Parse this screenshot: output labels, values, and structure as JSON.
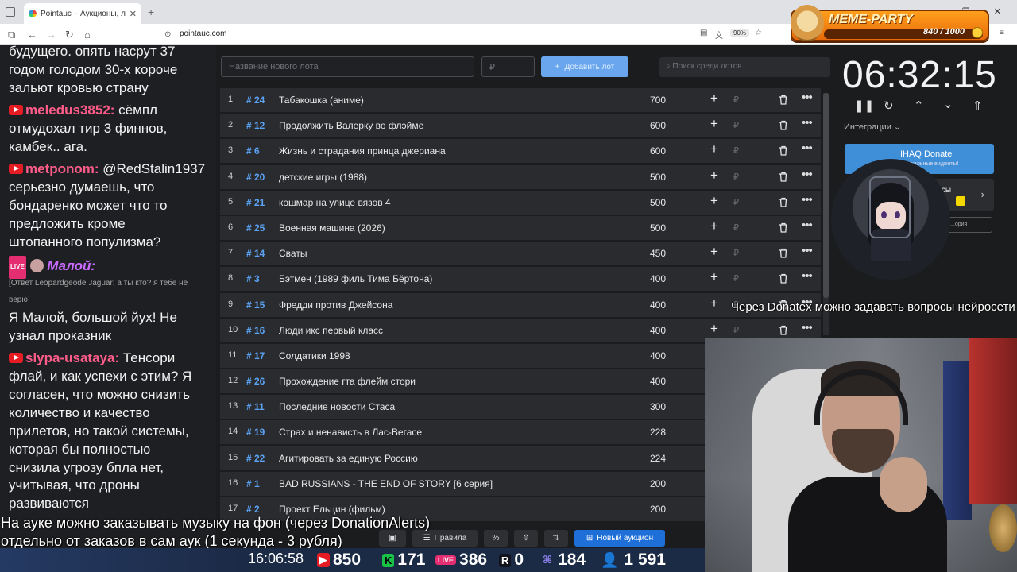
{
  "browser": {
    "tab_title": "Pointauc – Аукционы, лотереи",
    "url": "pointauc.com",
    "zoom": "90%"
  },
  "meme_party": {
    "title": "MEME-PARTY",
    "count": "840 / 1000"
  },
  "chat": {
    "lines": [
      {
        "text": "будущего. опять насрут 37"
      },
      {
        "text": "годом голодом 30-х короче"
      },
      {
        "text": "зальют кровью страну"
      },
      {
        "user": "meledus3852:",
        "text": " сёмпл"
      },
      {
        "text": "отмудохал тир 3 финнов,"
      },
      {
        "text": "камбек.. ага."
      },
      {
        "user": "metponom:",
        "text": " @RedStalin1937"
      },
      {
        "text": "серьезно думаешь, что"
      },
      {
        "text": "бондаренко может что то"
      },
      {
        "text": "предложить кроме"
      },
      {
        "text": "штопанного популизма?"
      },
      {
        "user": "Малой:"
      },
      {
        "reply": "[Ответ Leopardgeode Jaguar: а ты кто? я тебе не"
      },
      {
        "reply": "верю]"
      },
      {
        "text": "Я Малой, большой йух! Не"
      },
      {
        "text": "узнал проказник"
      },
      {
        "user": "slypa-usataya:",
        "text": " Тенсори"
      },
      {
        "text": "флай, и как успехи с этим? Я"
      },
      {
        "text": "согласен, что можно снизить"
      },
      {
        "text": "количество и качество"
      },
      {
        "text": "прилетов, но такой системы,"
      },
      {
        "text": "которая бы полностью"
      },
      {
        "text": "снизила угрозу бпла нет,"
      },
      {
        "text": "учитывая, что дроны"
      },
      {
        "text": "развиваются"
      }
    ]
  },
  "auction": {
    "new_lot_placeholder": "Название нового лота",
    "price_placeholder": "₽",
    "add_button": "Добавить лот",
    "search_placeholder": "Поиск среди лотов...",
    "currency": "₽",
    "lots": [
      {
        "n": "1",
        "id": "# 24",
        "name": "Табакошка (аниме)",
        "amount": "700"
      },
      {
        "n": "2",
        "id": "# 12",
        "name": "Продолжить Валерку во флэйме",
        "amount": "600"
      },
      {
        "n": "3",
        "id": "# 6",
        "name": "Жизнь и страдания принца джериана",
        "amount": "600"
      },
      {
        "n": "4",
        "id": "# 20",
        "name": "детские игры (1988)",
        "amount": "500"
      },
      {
        "n": "5",
        "id": "# 21",
        "name": "кошмар на улице вязов 4",
        "amount": "500"
      },
      {
        "n": "6",
        "id": "# 25",
        "name": "Военная машина (2026)",
        "amount": "500"
      },
      {
        "n": "7",
        "id": "# 14",
        "name": "Сваты",
        "amount": "450"
      },
      {
        "n": "8",
        "id": "# 3",
        "name": "Бэтмен (1989 филь Тима Бёртона)",
        "amount": "400"
      },
      {
        "n": "9",
        "id": "# 15",
        "name": "Фредди против Джейсона",
        "amount": "400"
      },
      {
        "n": "10",
        "id": "# 16",
        "name": "Люди икс первый класс",
        "amount": "400"
      },
      {
        "n": "11",
        "id": "# 17",
        "name": "Солдатики 1998",
        "amount": "400"
      },
      {
        "n": "12",
        "id": "# 26",
        "name": "Прохождение гта флейм стори",
        "amount": "400"
      },
      {
        "n": "13",
        "id": "# 11",
        "name": "Последние новости Стаса",
        "amount": "300"
      },
      {
        "n": "14",
        "id": "# 19",
        "name": "Страх и ненависть в Лас-Вегасе",
        "amount": "228"
      },
      {
        "n": "15",
        "id": "# 22",
        "name": "Агитировать за единую Россию",
        "amount": "224"
      },
      {
        "n": "16",
        "id": "# 1",
        "name": "BAD RUSSIANS - THE END OF STORY [6 серия]",
        "amount": "200"
      },
      {
        "n": "17",
        "id": "# 2",
        "name": "Проект Ельцин (фильм)",
        "amount": "200"
      }
    ],
    "toolbar": {
      "rules": "Правила",
      "percent": "%",
      "new_auction": "Новый аукцион"
    }
  },
  "right_panel": {
    "timer": "06:32:15",
    "integrations": "Интеграции",
    "donate_title": "IHAQ Donate",
    "donate_sub": "...никальные виджеты!",
    "card2_text": "...исы",
    "card3_text": "...ория"
  },
  "overlays": {
    "right_text": "Через Donatex можно задавать вопросы нейросети",
    "subtitle_1": "На ауке можно заказывать музыку на фон (через DonationAlerts)",
    "subtitle_2": "отдельно от заказов в сам аук (1 секунда - 3 рубля)"
  },
  "stats": {
    "time": "16:06:58",
    "youtube": "850",
    "kick": "171",
    "vk": "386",
    "rutube": "0",
    "other": "184",
    "total": "1 591"
  }
}
